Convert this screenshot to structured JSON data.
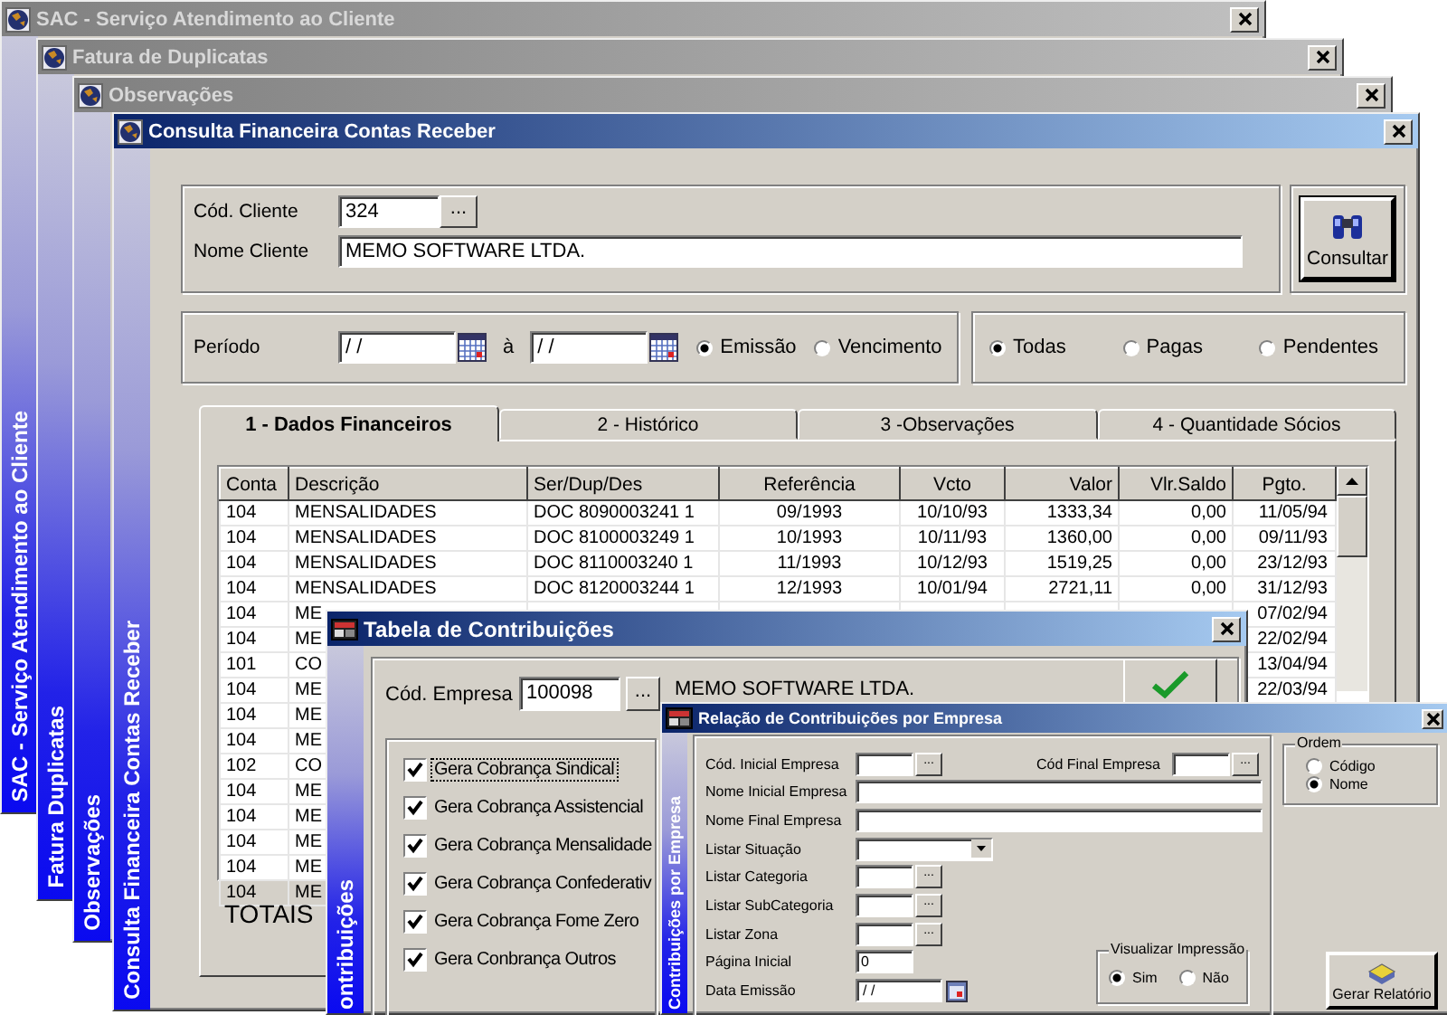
{
  "background_windows": [
    {
      "title": "SAC - Serviço Atendimento ao Cliente",
      "active": false,
      "sidebar_title": "SAC - Serviço Atendimento ao Cliente"
    },
    {
      "title": "Fatura de Duplicatas",
      "active": false,
      "sidebar_title": "Fatura Duplicatas"
    },
    {
      "title": "Observações",
      "active": false,
      "sidebar_title": "Observações"
    }
  ],
  "consulta": {
    "title": "Consulta Financeira Contas Receber",
    "active": true,
    "sidebar_title": "Consulta Financeira Contas Receber",
    "cliente": {
      "code_label": "Cód. Cliente",
      "code": "324",
      "lookup": "...",
      "name_label": "Nome Cliente",
      "name": "MEMO SOFTWARE LTDA."
    },
    "consultar_button": "Consultar",
    "periodo": {
      "label": "Período",
      "from": "/ /",
      "separator": "à",
      "to": "/ /",
      "options": [
        {
          "label": "Emissão",
          "selected": true
        },
        {
          "label": "Vencimento",
          "selected": false
        }
      ]
    },
    "situacao": [
      {
        "label": "Todas",
        "selected": true
      },
      {
        "label": "Pagas",
        "selected": false
      },
      {
        "label": "Pendentes",
        "selected": false
      }
    ],
    "tabs": [
      {
        "label": "1 - Dados Financeiros",
        "selected": true
      },
      {
        "label": "2 - Histórico",
        "selected": false
      },
      {
        "label": "3 -Observações",
        "selected": false
      },
      {
        "label": "4 - Quantidade Sócios",
        "selected": false
      }
    ],
    "table": {
      "columns": [
        "Conta",
        "Descrição",
        "Ser/Dup/Des",
        "Referência",
        "Vcto",
        "Valor",
        "Vlr.Saldo",
        "Pgto."
      ],
      "rows": [
        {
          "conta": "104",
          "descricao": "MENSALIDADES",
          "ser_dup_des": "DOC 8090003241 1",
          "referencia": "09/1993",
          "vcto": "10/10/93",
          "valor": "1333,34",
          "vlr_saldo": "0,00",
          "pgto": "11/05/94"
        },
        {
          "conta": "104",
          "descricao": "MENSALIDADES",
          "ser_dup_des": "DOC 8100003249 1",
          "referencia": "10/1993",
          "vcto": "10/11/93",
          "valor": "1360,00",
          "vlr_saldo": "0,00",
          "pgto": "09/11/93"
        },
        {
          "conta": "104",
          "descricao": "MENSALIDADES",
          "ser_dup_des": "DOC 8110003240 1",
          "referencia": "11/1993",
          "vcto": "10/12/93",
          "valor": "1519,25",
          "vlr_saldo": "0,00",
          "pgto": "23/12/93"
        },
        {
          "conta": "104",
          "descricao": "MENSALIDADES",
          "ser_dup_des": "DOC 8120003244 1",
          "referencia": "12/1993",
          "vcto": "10/01/94",
          "valor": "2721,11",
          "vlr_saldo": "0,00",
          "pgto": "31/12/93"
        },
        {
          "conta": "104",
          "descricao": "ME",
          "pgto": "07/02/94"
        },
        {
          "conta": "104",
          "descricao": "ME",
          "pgto": "22/02/94"
        },
        {
          "conta": "101",
          "descricao": "CO",
          "pgto": "13/04/94"
        },
        {
          "conta": "104",
          "descricao": "ME",
          "pgto": "22/03/94"
        },
        {
          "conta": "104",
          "descricao": "ME"
        },
        {
          "conta": "104",
          "descricao": "ME"
        },
        {
          "conta": "102",
          "descricao": "CO"
        },
        {
          "conta": "104",
          "descricao": "ME"
        },
        {
          "conta": "104",
          "descricao": "ME"
        },
        {
          "conta": "104",
          "descricao": "ME"
        },
        {
          "conta": "104",
          "descricao": "ME"
        },
        {
          "conta": "104",
          "descricao": "ME"
        }
      ]
    },
    "totals_label": "TOTAIS"
  },
  "tabela": {
    "title": "Tabela de Contribuições",
    "active": true,
    "sidebar_title": "ontribuições",
    "empresa_label": "Cód. Empresa",
    "empresa_code": "100098",
    "lookup": "...",
    "empresa_name": "MEMO SOFTWARE LTDA.",
    "options": [
      {
        "label": "Gera Cobrança Sindical",
        "checked": true
      },
      {
        "label": "Gera Cobrança Assistencial",
        "checked": true
      },
      {
        "label": "Gera Cobrança Mensalidade",
        "checked": true
      },
      {
        "label": "Gera Cobrança Confederativ",
        "checked": true
      },
      {
        "label": "Gera Cobrança Fome Zero",
        "checked": true
      },
      {
        "label": "Gera Conbrança Outros",
        "checked": true
      }
    ]
  },
  "relacao": {
    "title": "Relação de Contribuições por Empresa",
    "active": true,
    "sidebar_title": "Contribuições por Empresa",
    "cod_inicial_label": "Cód. Inicial Empresa",
    "cod_final_label": "Cód Final Empresa",
    "lookup": "...",
    "nome_inicial_label": "Nome Inicial Empresa",
    "nome_final_label": "Nome Final Empresa",
    "situacao_label": "Listar Situação",
    "categoria_label": "Listar Categoria",
    "subcategoria_label": "Listar SubCategoria",
    "zona_label": "Listar Zona",
    "pagina_label": "Página Inicial",
    "pagina": "0",
    "data_label": "Data Emissão",
    "data": "/ /",
    "visualizar": {
      "label": "Visualizar Impressão",
      "options": [
        {
          "label": "Sim",
          "selected": true
        },
        {
          "label": "Não",
          "selected": false
        }
      ]
    },
    "ordem": {
      "label": "Ordem",
      "options": [
        {
          "label": "Código",
          "selected": false
        },
        {
          "label": "Nome",
          "selected": true
        }
      ]
    },
    "gerar_button": "Gerar Relatório"
  }
}
